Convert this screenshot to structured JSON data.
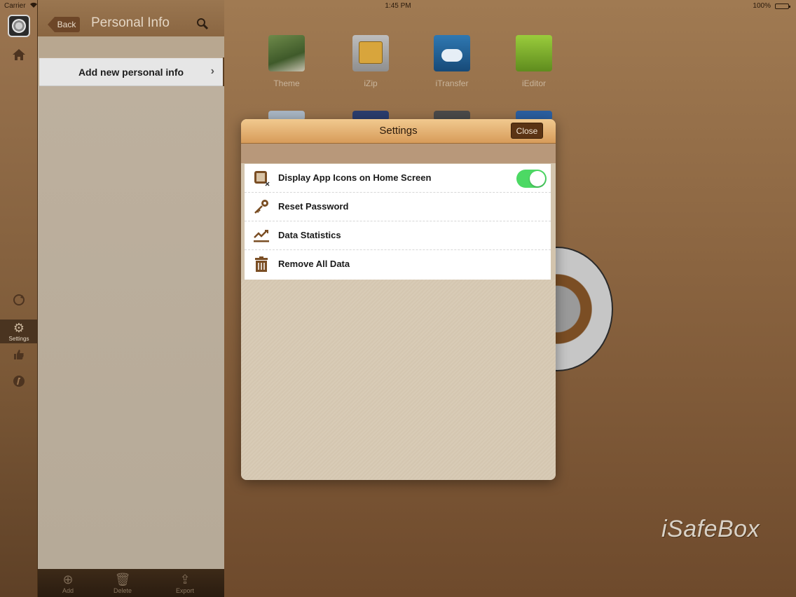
{
  "status": {
    "carrier": "Carrier",
    "time": "1:45 PM",
    "battery": "100%"
  },
  "rail": {
    "settings_label": "Settings"
  },
  "panel": {
    "back_label": "Back",
    "title": "Personal Info",
    "add_row_label": "Add new personal info",
    "bottom": {
      "add": "Add",
      "delete": "Delete",
      "export": "Export"
    }
  },
  "home_apps": [
    {
      "name": "Theme",
      "color": "#5a7a3a"
    },
    {
      "name": "iZip",
      "color": "#c9a24a"
    },
    {
      "name": "iTransfer",
      "color": "#1f5a8a"
    },
    {
      "name": "iEditor",
      "color": "#7fae2e"
    }
  ],
  "brand": "iSafeBox",
  "settings_modal": {
    "title": "Settings",
    "close_label": "Close",
    "rows": [
      {
        "label": "Display App Icons on Home Screen",
        "icon": "app-icon-square",
        "toggle": true
      },
      {
        "label": "Reset Password",
        "icon": "key-icon"
      },
      {
        "label": "Data Statistics",
        "icon": "chart-icon"
      },
      {
        "label": "Remove All Data",
        "icon": "trash-icon"
      }
    ]
  }
}
